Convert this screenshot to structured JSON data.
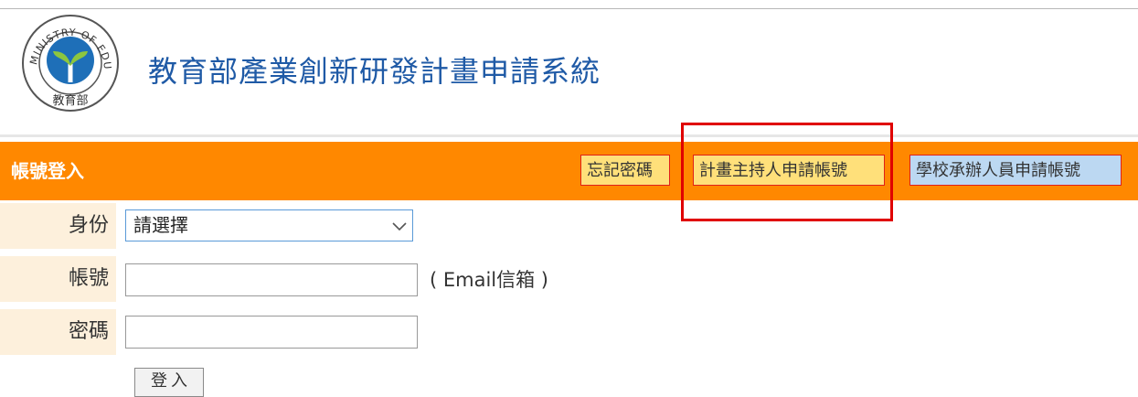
{
  "header": {
    "site_title": "教育部產業創新研發計畫申請系統",
    "logo_text_ring": "MINISTRY OF EDUCATION",
    "logo_text_bottom": "教育部"
  },
  "login_bar": {
    "title": "帳號登入",
    "forgot_password": "忘記密碼",
    "pi_apply": "計畫主持人申請帳號",
    "school_apply": "學校承辦人員申請帳號"
  },
  "form": {
    "role_label": "身份",
    "role_selected": "請選擇",
    "account_label": "帳號",
    "account_value": "",
    "account_hint": "( Email信箱 )",
    "password_label": "密碼",
    "password_value": "",
    "submit_label": "登入"
  },
  "colors": {
    "bar": "#ff8800",
    "title_blue": "#1f5aa6",
    "label_bg": "#fdf0dc",
    "yellow_button": "#ffe07a",
    "blue_button": "#bcd8f2",
    "highlight": "#e00000"
  }
}
